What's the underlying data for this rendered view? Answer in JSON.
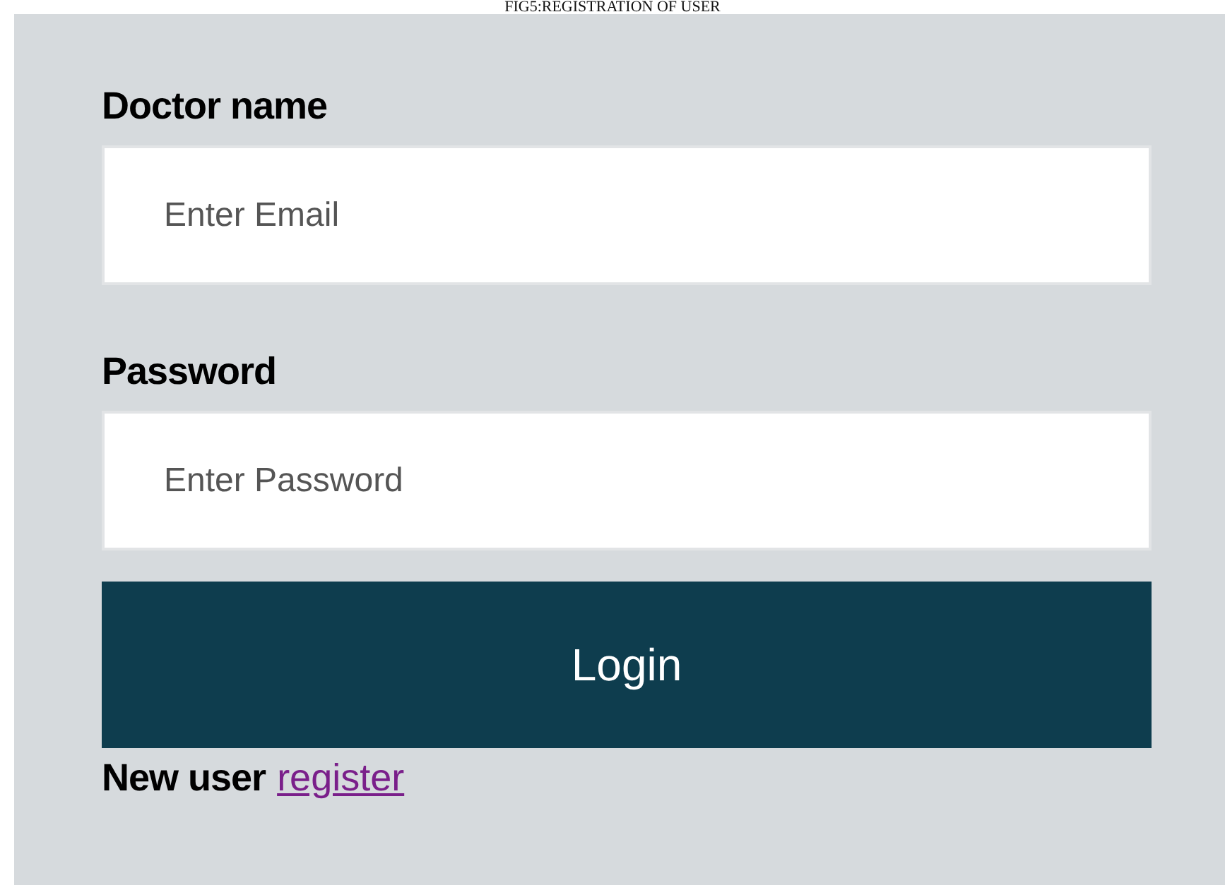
{
  "caption": "FIG5:REGISTRATION OF USER",
  "fields": [
    {
      "label": "Doctor name",
      "placeholder": "Enter Email"
    },
    {
      "label": "Password",
      "placeholder": "Enter Password"
    }
  ],
  "button": "Login",
  "footer": {
    "text": "New user",
    "link": "register"
  }
}
